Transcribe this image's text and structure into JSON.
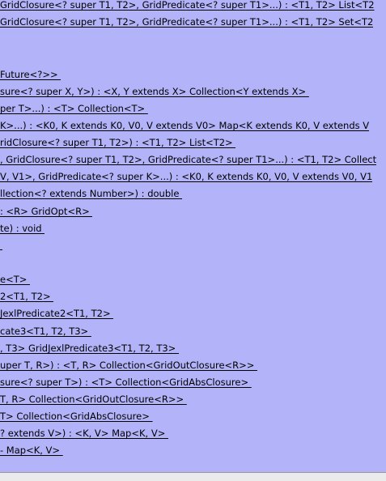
{
  "rows": [
    {
      "text": "GridClosure<? super T1, T2>, GridPredicate<? super T1>...) : <T1, T2> List<T2",
      "link": true
    },
    {
      "text": "GridClosure<? super T1, T2>, GridPredicate<? super T1>...) : <T1, T2> Set<T2",
      "link": true
    },
    {
      "text": "",
      "link": false
    },
    {
      "text": "",
      "link": false
    },
    {
      "text": "Future<?>> ",
      "link": true
    },
    {
      "text": "sure<? super X, Y>) : <X, Y extends X> Collection<Y extends X> ",
      "link": true
    },
    {
      "text": "per T>...) : <T> Collection<T> ",
      "link": true
    },
    {
      "text": "K>...) : <K0, K extends K0, V0, V extends V0> Map<K extends K0, V extends V",
      "link": true
    },
    {
      "text": "ridClosure<? super T1, T2>) : <T1, T2> List<T2> ",
      "link": true
    },
    {
      "text": ", GridClosure<? super T1, T2>, GridPredicate<? super T1>...) : <T1, T2> Collect",
      "link": true
    },
    {
      "text": "V, V1>, GridPredicate<? super K>...) : <K0, K extends K0, V0, V extends V0, V1",
      "link": true
    },
    {
      "text": "llection<? extends Number>) : double ",
      "link": true
    },
    {
      "text": ": <R> GridOpt<R> ",
      "link": true
    },
    {
      "text": "te) : void ",
      "link": true
    },
    {
      "text": "",
      "link": true
    },
    {
      "text": "",
      "link": false
    },
    {
      "text": "e<T> ",
      "link": true
    },
    {
      "text": "2<T1, T2> ",
      "link": true
    },
    {
      "text": "JexlPredicate2<T1, T2> ",
      "link": true
    },
    {
      "text": "cate3<T1, T2, T3> ",
      "link": true
    },
    {
      "text": ", T3> GridJexlPredicate3<T1, T2, T3> ",
      "link": true
    },
    {
      "text": "uper T, R>) : <T, R> Collection<GridOutClosure<R>> ",
      "link": true
    },
    {
      "text": "sure<? super T>) : <T> Collection<GridAbsClosure> ",
      "link": true
    },
    {
      "text": "T, R> Collection<GridOutClosure<R>> ",
      "link": true
    },
    {
      "text": "T> Collection<GridAbsClosure> ",
      "link": true
    },
    {
      "text": "? extends V>) : <K, V> Map<K, V> ",
      "link": true
    },
    {
      "text": "- Map<K, V> ",
      "link": true
    }
  ]
}
